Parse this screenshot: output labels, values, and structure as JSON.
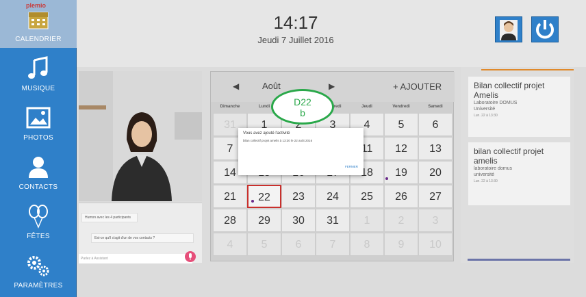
{
  "sidebar": {
    "items": [
      {
        "label": "CALENDRIER",
        "icon": "calendar-icon"
      },
      {
        "label": "MUSIQUE",
        "icon": "music-note-icon"
      },
      {
        "label": "PHOTOS",
        "icon": "photo-icon"
      },
      {
        "label": "CONTACTS",
        "icon": "person-icon"
      },
      {
        "label": "FÊTES",
        "icon": "balloons-icon"
      },
      {
        "label": "PARAMÈTRES",
        "icon": "gears-icon"
      }
    ],
    "logo_text": "plemio"
  },
  "header": {
    "time": "14:17",
    "date": "Jeudi 7 Juillet 2016"
  },
  "chat": {
    "msg1": "Humon avec les 4 participants",
    "msg2": "Est-ce qu'il s'agit d'un de vos contacts ?",
    "input_placeholder": "Parlez à Assistant"
  },
  "calendar": {
    "month": "Août",
    "add_label": "+ AJOUTER",
    "weekdays": [
      "Dimanche",
      "Lundi",
      "Mardi",
      "Mercredi",
      "Jeudi",
      "Vendredi",
      "Samedi"
    ],
    "weeks": [
      [
        "31",
        "1",
        "2",
        "3",
        "4",
        "5",
        "6"
      ],
      [
        "7",
        "8",
        "9",
        "10",
        "11",
        "12",
        "13"
      ],
      [
        "14",
        "15",
        "16",
        "17",
        "18",
        "19",
        "20"
      ],
      [
        "21",
        "22",
        "23",
        "24",
        "25",
        "26",
        "27"
      ],
      [
        "28",
        "29",
        "30",
        "31",
        "1",
        "2",
        "3"
      ],
      [
        "4",
        "5",
        "6",
        "7",
        "8",
        "9",
        "10"
      ]
    ]
  },
  "modal": {
    "title": "Vous avez ajouté l'activité",
    "body": "bilan collectif projet amelis à 13:30 le 22 août 2016",
    "action": "FERMER"
  },
  "annotation": {
    "line1": "D22",
    "line2": "b"
  },
  "events": [
    {
      "title": "Bilan collectif projet Amelis",
      "line2": "Laboratoire DOMUS",
      "line3": "Université",
      "time": "Lun. 22 à 13:30"
    },
    {
      "title": "bilan collectif projet amelis",
      "line2": "laboratoire domus",
      "line3": "université",
      "time": "Lun. 22 à 13:30"
    }
  ],
  "colors": {
    "accent": "#2f80c9",
    "selection": "#c9302c",
    "annotation": "#2aa84a",
    "event_border": "#e08a2c"
  }
}
